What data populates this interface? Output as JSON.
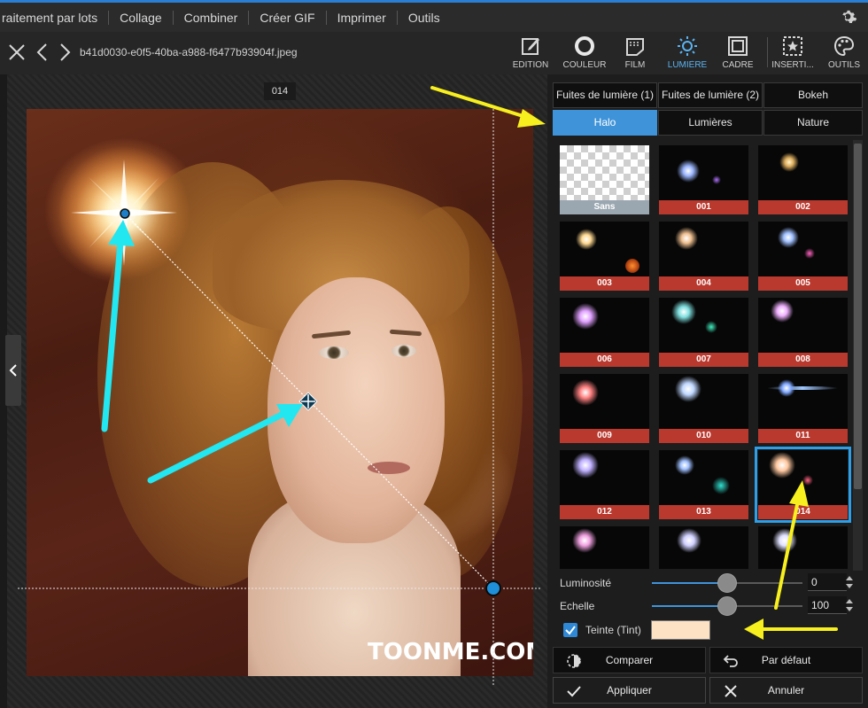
{
  "menubar": {
    "items": [
      "raitement par lots",
      "Collage",
      "Combiner",
      "Créer GIF",
      "Imprimer",
      "Outils"
    ]
  },
  "toolbar": {
    "filename": "b41d0030-e0f5-40ba-a988-f6477b93904f.jpeg",
    "tools": [
      {
        "label": "EDITION",
        "icon": "edit-icon"
      },
      {
        "label": "COULEUR",
        "icon": "color-circle-icon"
      },
      {
        "label": "FILM",
        "icon": "film-icon"
      },
      {
        "label": "LUMIÈRE",
        "icon": "sun-icon"
      },
      {
        "label": "CADRE",
        "icon": "frame-icon"
      },
      {
        "label": "INSERTI...",
        "icon": "insert-star-icon"
      },
      {
        "label": "OUTILS",
        "icon": "palette-icon"
      }
    ],
    "active_tool": "LUMIÈRE"
  },
  "canvas": {
    "image_label": "014",
    "watermark": "TOONME.COM"
  },
  "panel": {
    "tabs": [
      "Fuites de lumière (1)",
      "Fuites de lumière (2)",
      "Bokeh",
      "Halo",
      "Lumières",
      "Nature"
    ],
    "active_tab": "Halo",
    "thumbnails": [
      "Sans",
      "001",
      "002",
      "003",
      "004",
      "005",
      "006",
      "007",
      "008",
      "009",
      "010",
      "011",
      "012",
      "013",
      "014",
      "",
      "",
      ""
    ],
    "selected_thumbnail": "014",
    "sliders": [
      {
        "label": "Luminosité",
        "value": "0",
        "fraction": 0.5
      },
      {
        "label": "Echelle",
        "value": "100",
        "fraction": 0.5
      }
    ],
    "tint": {
      "label": "Teinte (Tint)",
      "checked": true,
      "color": "#fde2c4"
    },
    "buttons": {
      "compare": "Comparer",
      "default": "Par défaut",
      "apply": "Appliquer",
      "cancel": "Annuler"
    }
  },
  "colors": {
    "accent": "#3f93d9",
    "caption_red": "#b9392e",
    "arrow_cyan": "#22e6f0",
    "arrow_yellow": "#f7f01e"
  }
}
